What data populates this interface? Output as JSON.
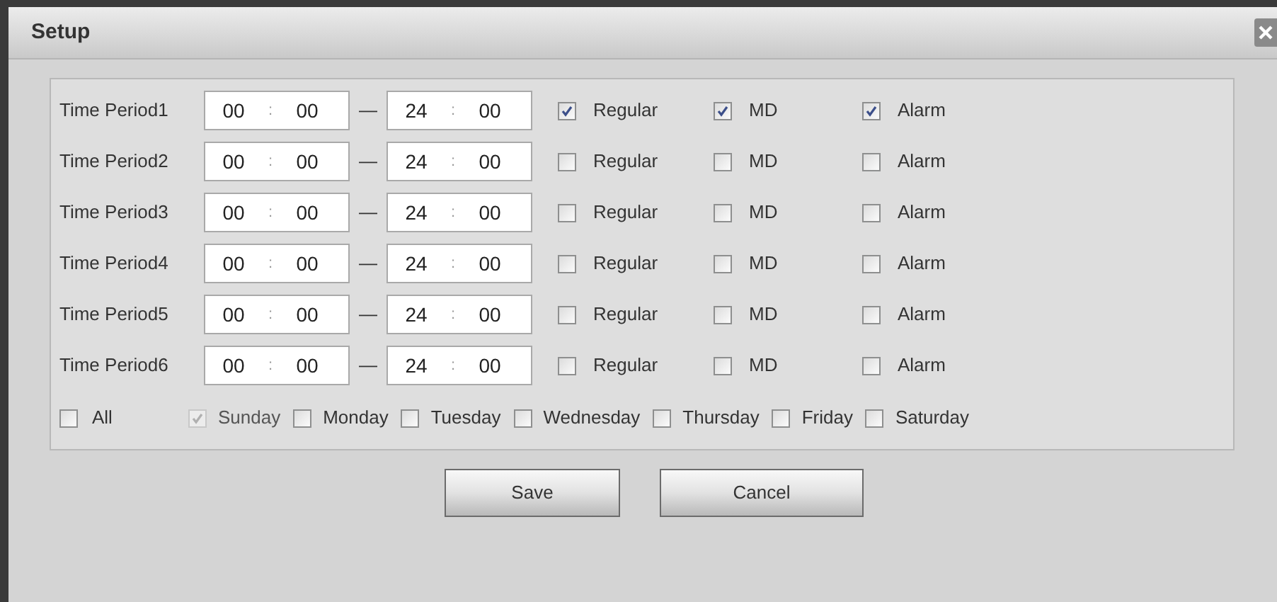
{
  "window": {
    "title": "Setup"
  },
  "periods": [
    {
      "label": "Time Period1",
      "start_hour": "00",
      "start_minute": "00",
      "end_hour": "24",
      "end_minute": "00",
      "separator": ":",
      "dash": "—",
      "options": [
        {
          "label": "Regular",
          "checked": true
        },
        {
          "label": "MD",
          "checked": true
        },
        {
          "label": "Alarm",
          "checked": true
        }
      ]
    },
    {
      "label": "Time Period2",
      "start_hour": "00",
      "start_minute": "00",
      "end_hour": "24",
      "end_minute": "00",
      "separator": ":",
      "dash": "—",
      "options": [
        {
          "label": "Regular",
          "checked": false
        },
        {
          "label": "MD",
          "checked": false
        },
        {
          "label": "Alarm",
          "checked": false
        }
      ]
    },
    {
      "label": "Time Period3",
      "start_hour": "00",
      "start_minute": "00",
      "end_hour": "24",
      "end_minute": "00",
      "separator": ":",
      "dash": "—",
      "options": [
        {
          "label": "Regular",
          "checked": false
        },
        {
          "label": "MD",
          "checked": false
        },
        {
          "label": "Alarm",
          "checked": false
        }
      ]
    },
    {
      "label": "Time Period4",
      "start_hour": "00",
      "start_minute": "00",
      "end_hour": "24",
      "end_minute": "00",
      "separator": ":",
      "dash": "—",
      "options": [
        {
          "label": "Regular",
          "checked": false
        },
        {
          "label": "MD",
          "checked": false
        },
        {
          "label": "Alarm",
          "checked": false
        }
      ]
    },
    {
      "label": "Time Period5",
      "start_hour": "00",
      "start_minute": "00",
      "end_hour": "24",
      "end_minute": "00",
      "separator": ":",
      "dash": "—",
      "options": [
        {
          "label": "Regular",
          "checked": false
        },
        {
          "label": "MD",
          "checked": false
        },
        {
          "label": "Alarm",
          "checked": false
        }
      ]
    },
    {
      "label": "Time Period6",
      "start_hour": "00",
      "start_minute": "00",
      "end_hour": "24",
      "end_minute": "00",
      "separator": ":",
      "dash": "—",
      "options": [
        {
          "label": "Regular",
          "checked": false
        },
        {
          "label": "MD",
          "checked": false
        },
        {
          "label": "Alarm",
          "checked": false
        }
      ]
    }
  ],
  "all": {
    "label": "All",
    "checked": false
  },
  "days": [
    {
      "label": "Sunday",
      "checked": true,
      "disabled": true
    },
    {
      "label": "Monday",
      "checked": false,
      "disabled": false
    },
    {
      "label": "Tuesday",
      "checked": false,
      "disabled": false
    },
    {
      "label": "Wednesday",
      "checked": false,
      "disabled": false
    },
    {
      "label": "Thursday",
      "checked": false,
      "disabled": false
    },
    {
      "label": "Friday",
      "checked": false,
      "disabled": false
    },
    {
      "label": "Saturday",
      "checked": false,
      "disabled": false
    }
  ],
  "buttons": [
    "Save",
    "Cancel"
  ]
}
